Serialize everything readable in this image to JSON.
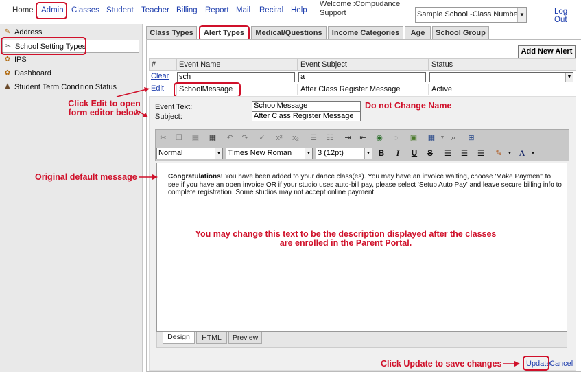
{
  "nav": {
    "items": [
      "Home",
      "Admin",
      "Classes",
      "Student",
      "Teacher",
      "Billing",
      "Report",
      "Mail",
      "Recital",
      "Help"
    ],
    "welcome": "Welcome :Compudance Support",
    "school_select": "Sample School -Class Number",
    "logout": "Log Out"
  },
  "sidebar": {
    "items": [
      "Address",
      "School Setting Types",
      "IPS",
      "Dashboard",
      "Student Term Condition Status"
    ]
  },
  "tabs": [
    "Class Types",
    "Alert Types",
    "Medical/Questions",
    "Income Categories",
    "Age",
    "School Group"
  ],
  "add_button": "Add New Alert",
  "grid": {
    "headers": [
      "#",
      "Event Name",
      "Event Subject",
      "Status"
    ],
    "filter": {
      "clear": "Clear",
      "name": "sch",
      "subject": "a"
    },
    "row": {
      "action": "Edit",
      "name": "SchoolMessage",
      "subject": "After Class Register Message",
      "status": "Active"
    }
  },
  "edit": {
    "event_text_label": "Event Text:",
    "event_text_value": "SchoolMessage",
    "subject_label": "Subject:",
    "subject_value": "After Class Register Message"
  },
  "toolbar": {
    "paragraph": "Normal",
    "font": "Times New Roman",
    "size": "3 (12pt)"
  },
  "editor": {
    "bold_lead": "Congratulations!",
    "body": "  You have been added to your dance class(es). You may have an invoice waiting, choose 'Make Payment' to see if you have an open invoice OR if your studio uses auto-bill pay, please select 'Setup Auto Pay' and leave secure billing info to complete registration. Some studios may not accept online payment."
  },
  "mode_tabs": [
    "Design",
    "HTML",
    "Preview"
  ],
  "actions": {
    "update": "Update",
    "cancel": "Cancel"
  },
  "annotations": {
    "click_edit_1": "Click Edit to open",
    "click_edit_2": "form editor below",
    "do_not_change": "Do not Change Name",
    "original": "Original default message",
    "may_change_1": "You may change this text to be the description displayed after the classes",
    "may_change_2": "are enrolled in the Parent Portal.",
    "click_update": "Click Update to save changes"
  },
  "colors": {
    "annotation": "#d0102a",
    "link": "#1f3fae"
  }
}
